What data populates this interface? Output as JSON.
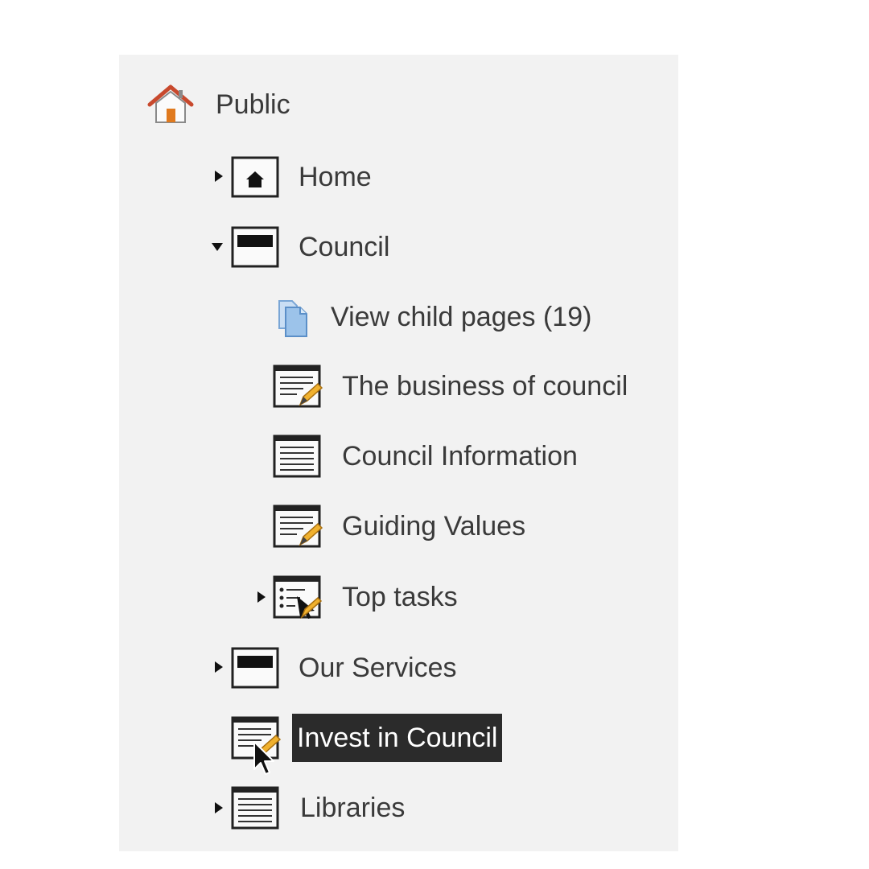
{
  "tree": {
    "root": {
      "label": "Public",
      "icon": "house-icon"
    },
    "items": [
      {
        "label": "Home",
        "icon": "home-page-icon",
        "toggle": "collapsed"
      },
      {
        "label": "Council",
        "icon": "section-page-icon",
        "toggle": "expanded"
      },
      {
        "label": "View child pages (19)",
        "icon": "child-pages-icon"
      },
      {
        "label": "The business of council",
        "icon": "edit-page-icon"
      },
      {
        "label": "Council Information",
        "icon": "text-page-icon"
      },
      {
        "label": "Guiding Values",
        "icon": "edit-page-icon"
      },
      {
        "label": "Top tasks",
        "icon": "task-list-icon",
        "toggle": "collapsed"
      },
      {
        "label": "Our Services",
        "icon": "section-page-icon",
        "toggle": "collapsed"
      },
      {
        "label": "Invest in Council",
        "icon": "edit-page-icon",
        "selected": true
      },
      {
        "label": "Libraries",
        "icon": "text-page-icon",
        "toggle": "collapsed"
      }
    ]
  },
  "colors": {
    "panel_bg": "#f2f2f2",
    "selected_bg": "#2b2b2b",
    "house_roof": "#c8492d",
    "house_door": "#e07a1f",
    "pencil": "#f0b12e",
    "child_pages_icon": "#9cc3ea"
  }
}
